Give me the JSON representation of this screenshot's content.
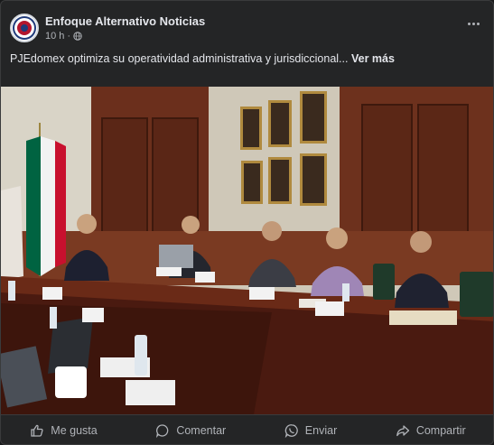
{
  "post": {
    "page_name": "Enfoque Alternativo Noticias",
    "time": "10 h",
    "separator": "·",
    "audience_icon": "globe-icon",
    "text": "PJEdomex optimiza su operatividad administrativa y jurisdiccional...",
    "see_more": "Ver más",
    "photo_alt": "Reunión de trabajo en sala de juntas"
  },
  "actions": {
    "like": "Me gusta",
    "comment": "Comentar",
    "send": "Enviar",
    "share": "Compartir"
  },
  "colors": {
    "card_bg": "#242526",
    "text_primary": "#e4e6eb",
    "text_secondary": "#b0b3b8"
  }
}
